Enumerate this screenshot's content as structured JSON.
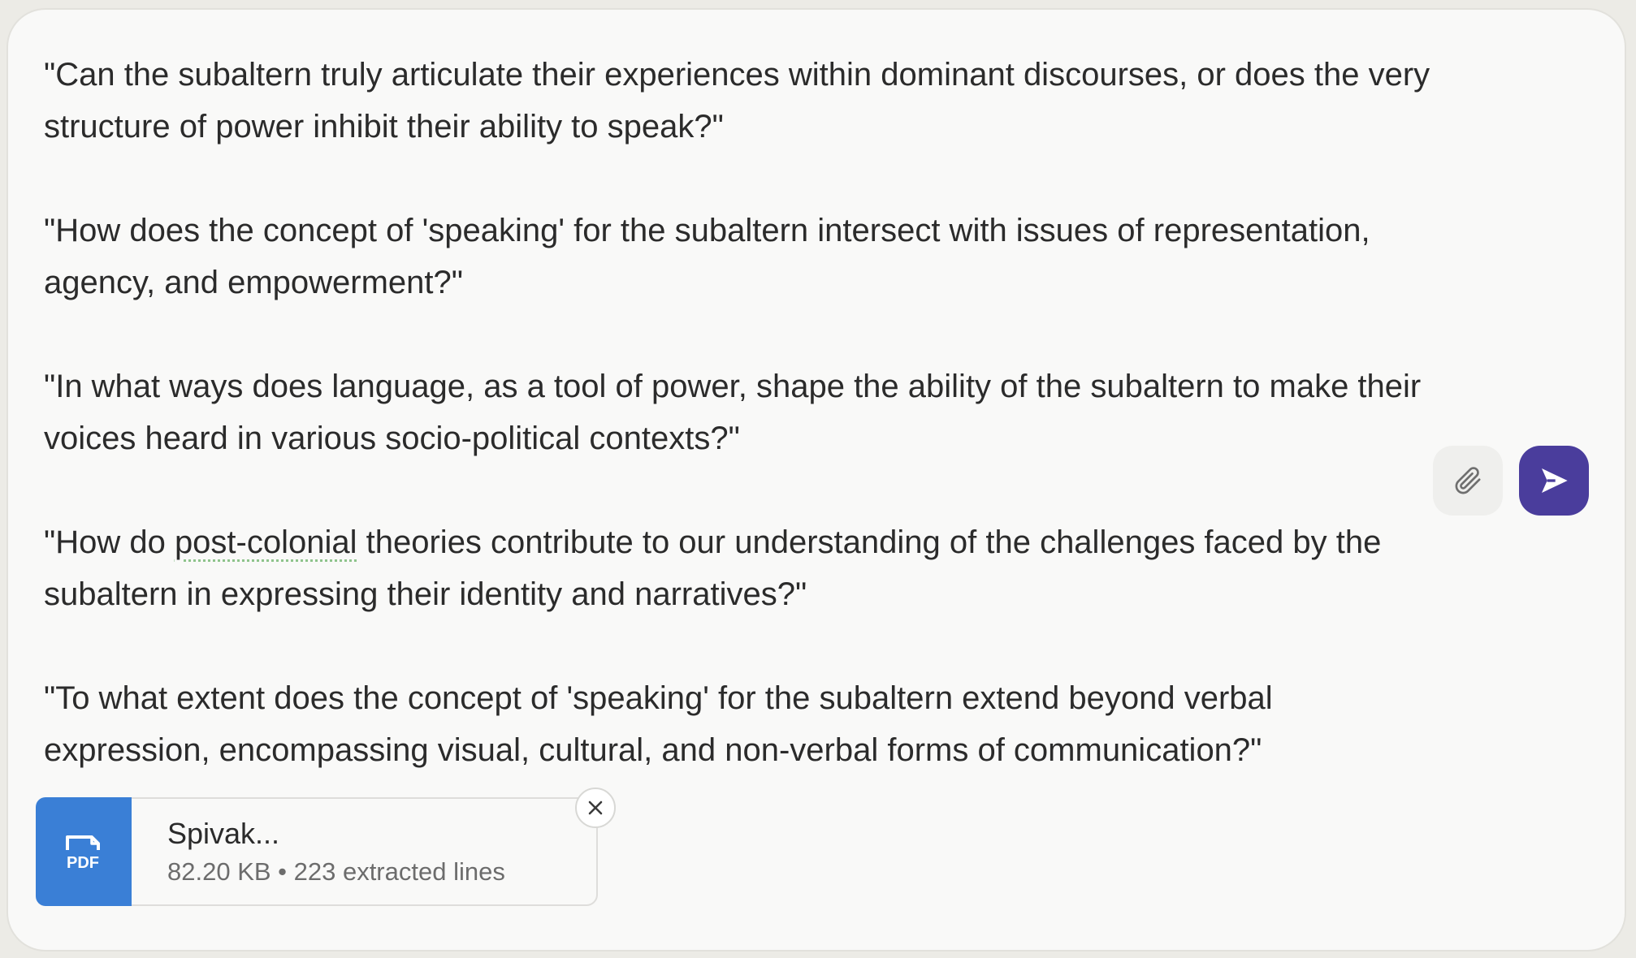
{
  "composer": {
    "paragraphs": [
      "\"Can the subaltern truly articulate their experiences within dominant discourses, or does the very structure of power inhibit their ability to speak?\"",
      "\"How does the concept of 'speaking' for the subaltern intersect with issues of representation, agency, and empowerment?\"",
      "\"In what ways does language, as a tool of power, shape the ability of the subaltern to make their voices heard in various socio-political contexts?\"",
      {
        "before": "\"How do ",
        "flagged": "post-colonial",
        "after": " theories contribute to our understanding of the challenges faced by the subaltern in expressing their identity and narratives?\""
      },
      "\"To what extent does the concept of 'speaking' for the subaltern extend beyond verbal expression, encompassing visual, cultural, and non-verbal forms of communication?\""
    ]
  },
  "actions": {
    "attach_icon": "paperclip-icon",
    "send_icon": "send-arrow-icon"
  },
  "attachment": {
    "type_label": "PDF",
    "name": "Spivak...",
    "meta": "82.20 KB • 223 extracted lines",
    "icon_color": "#3a7fd6"
  },
  "colors": {
    "send_button": "#4a3d9c",
    "spellcheck_underline": "#8fc48c"
  }
}
